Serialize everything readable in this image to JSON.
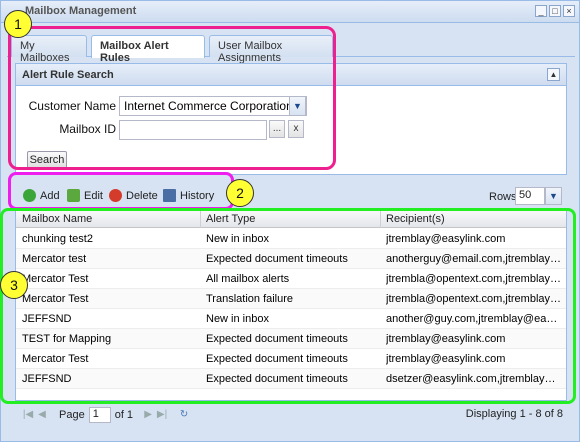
{
  "window": {
    "title": "Mailbox Management",
    "controls": [
      "_",
      "□",
      "×"
    ]
  },
  "tabs": [
    {
      "label": "My Mailboxes",
      "active": false
    },
    {
      "label": "Mailbox Alert Rules",
      "active": true
    },
    {
      "label": "User Mailbox Assignments",
      "active": false
    }
  ],
  "search_panel": {
    "title": "Alert Rule Search",
    "customer_label": "Customer Name",
    "customer_value": "Internet Commerce Corporation",
    "mailbox_label": "Mailbox ID",
    "mailbox_value": "",
    "browse_label": "...",
    "clear_label": "x",
    "search_button": "Search"
  },
  "toolbar": {
    "add": "Add",
    "edit": "Edit",
    "delete": "Delete",
    "history": "History",
    "rows_label": "Rows:",
    "rows_value": "50"
  },
  "grid": {
    "columns": [
      "Mailbox Name",
      "Alert Type",
      "Recipient(s)"
    ],
    "rows": [
      [
        "chunking test2",
        "New in inbox",
        "jtremblay@easylink.com"
      ],
      [
        "Mercator test",
        "Expected document timeouts",
        "anotherguy@email.com,jtremblay@e..."
      ],
      [
        "Mercator Test",
        "All mailbox alerts",
        "jtrembla@opentext.com,jtremblay@e..."
      ],
      [
        "Mercator Test",
        "Translation failure",
        "jtrembla@opentext.com,jtremblay@e..."
      ],
      [
        "JEFFSND",
        "New in inbox",
        "another@guy.com,jtremblay@easyli..."
      ],
      [
        "TEST for Mapping",
        "Expected document timeouts",
        "jtremblay@easylink.com"
      ],
      [
        "Mercator Test",
        "Expected document timeouts",
        "jtremblay@easylink.com"
      ],
      [
        "JEFFSND",
        "Expected document timeouts",
        "dsetzer@easylink.com,jtremblay@ea..."
      ]
    ]
  },
  "pager": {
    "page_label": "Page",
    "page_value": "1",
    "of_label": "of 1",
    "display_info": "Displaying 1 - 8 of 8"
  },
  "annotations": [
    {
      "label": "1",
      "color": "#ee1f8e"
    },
    {
      "label": "2",
      "color": "#ee1fee"
    },
    {
      "label": "3",
      "color": "#22ee22"
    }
  ],
  "colors": {
    "accent": "#99bbe8",
    "add_icon": "#3aa63a",
    "delete_icon": "#d43b2b"
  }
}
